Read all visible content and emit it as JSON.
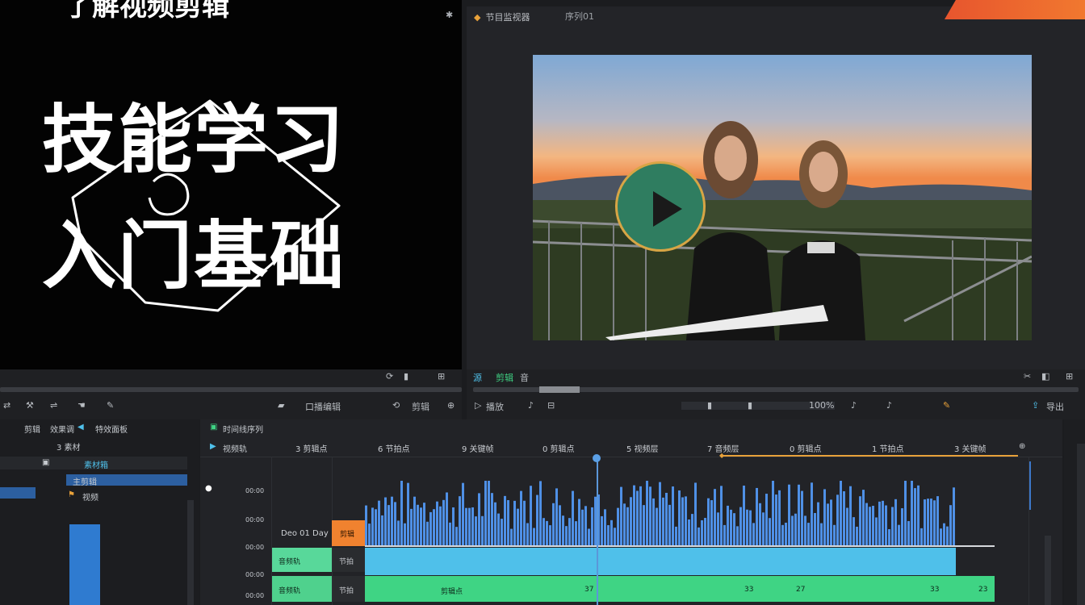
{
  "source_monitor": {
    "top_title": "了解视频剪辑",
    "line1": "技能学习",
    "line2": "入门基础",
    "controls_right": [
      "⟳",
      "▮",
      "⊞"
    ],
    "toolbar_label": "口播编辑",
    "toolbar_right": "剪辑"
  },
  "program_monitor": {
    "tab_title": "节目监视器",
    "tab_title2": "序列01",
    "status_left": [
      "源",
      "剪辑",
      "音"
    ],
    "controls_right": [
      "✂",
      "◧",
      "⊞"
    ],
    "toolbar": [
      "▷",
      "播放",
      "♪",
      "⊟",
      "▮",
      "▮",
      "100%",
      "♪",
      "♪"
    ],
    "export_label": "导出"
  },
  "project_panel": {
    "header": [
      "剪辑",
      "效果调",
      "特效面板"
    ],
    "subheader": "3 素材",
    "bin_label": "素材箱",
    "selected_item": "主剪辑",
    "file_item": "视频"
  },
  "timeline": {
    "title": "时间线序列",
    "track_header": "视频轨",
    "ruler": [
      "3 剪辑点",
      "6 节拍点",
      "9 关键帧",
      "0 剪辑点",
      "5 视频层",
      "7 音频层",
      "0 剪辑点",
      "1 节拍点",
      "3 关键帧"
    ],
    "row_labels": [
      "00:00",
      "00:00",
      "00:00",
      "00:00",
      "00:00"
    ],
    "clip_text": "Deo 01 Day",
    "orange_clip": "剪辑",
    "green_a": "音频轨",
    "green_b": "音频轨",
    "dark_a": "节拍",
    "dark_b": "节拍",
    "bottom_markers": [
      "剪辑点",
      "37",
      "33",
      "27",
      "33",
      "23"
    ]
  },
  "colors": {
    "accent_green": "#3fd484",
    "accent_cyan": "#4fc0ea",
    "wave_blue": "#4f90e6",
    "orange": "#f0822f",
    "playhead": "#5b97d9"
  }
}
